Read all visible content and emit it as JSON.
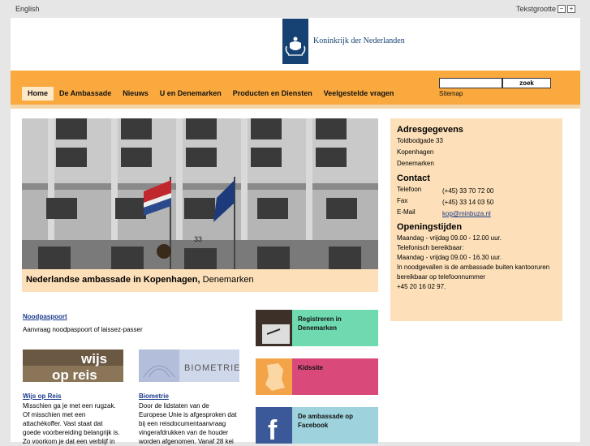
{
  "topbar": {
    "language_link": "English",
    "text_size_label": "Tekstgrootte",
    "text_smaller": "−",
    "text_larger": "+"
  },
  "header": {
    "org_name": "Koninkrijk der Nederlanden"
  },
  "nav": {
    "items": [
      "Home",
      "De Ambassade",
      "Nieuws",
      "U en Denemarken",
      "Producten en Diensten",
      "Veelgestelde vragen"
    ],
    "search_button": "zoek",
    "sitemap": "Sitemap"
  },
  "hero": {
    "caption_bold": "Nederlandse ambassade in Kopenhagen,",
    "caption_rest": " Denemarken",
    "number_plate": "33"
  },
  "contact": {
    "address_heading": "Adresgegevens",
    "address_lines": [
      "Toldbodgade 33",
      "Kopenhagen",
      "Denemarken"
    ],
    "contact_heading": "Contact",
    "phone_label": "Telefoon",
    "phone": "(+45) 33 70 72 00",
    "fax_label": "Fax",
    "fax": "(+45) 33 14 03 50",
    "email_label": "E-Mail",
    "email": "kop@minbuza.nl",
    "hours_heading": "Openingstijden",
    "hours_lines": [
      "Maandag - vrijdag 09.00 - 12.00 uur.",
      "Telefonisch bereikbaar:",
      "Maandag - vrijdag 09.00 - 16.30 uur.",
      "In noodgevallen is de ambassade buiten kantooruren",
      "bereikbaar op telefoonnummer",
      "+45 20 16 02 97."
    ]
  },
  "articles": {
    "noodpaspoort": {
      "title": "Noodpaspoort",
      "text": "Aanvraag noodpaspoort of laissez-passer"
    },
    "wijs": {
      "thumb_text": "wijs op reis",
      "title": "Wijs op Reis",
      "lines": [
        "Misschien ga je met een rugzak.",
        "Of misschien met een",
        "attachékoffer. Vast staat dat",
        "goede voorbereiding belangrijk is.",
        "Zo voorkom je dat een verblijf in"
      ]
    },
    "biometrie": {
      "thumb_text": "BIOMETRIE",
      "title": "Biometrie",
      "lines": [
        "Door de lidstaten van de",
        "Europese Unie is afgesproken dat",
        "bij een reisdocumentaanvraag",
        "vingerafdrukken van de houder",
        "worden afgenomen. Vanaf 28 kei"
      ]
    }
  },
  "tiles": [
    {
      "label": "Registreren in Denemarken",
      "color": "#6fd9b0"
    },
    {
      "label": "Kidssite",
      "color": "#d94a7a"
    },
    {
      "label": "De ambassade op Facebook",
      "color": "#9ed2dc"
    }
  ]
}
